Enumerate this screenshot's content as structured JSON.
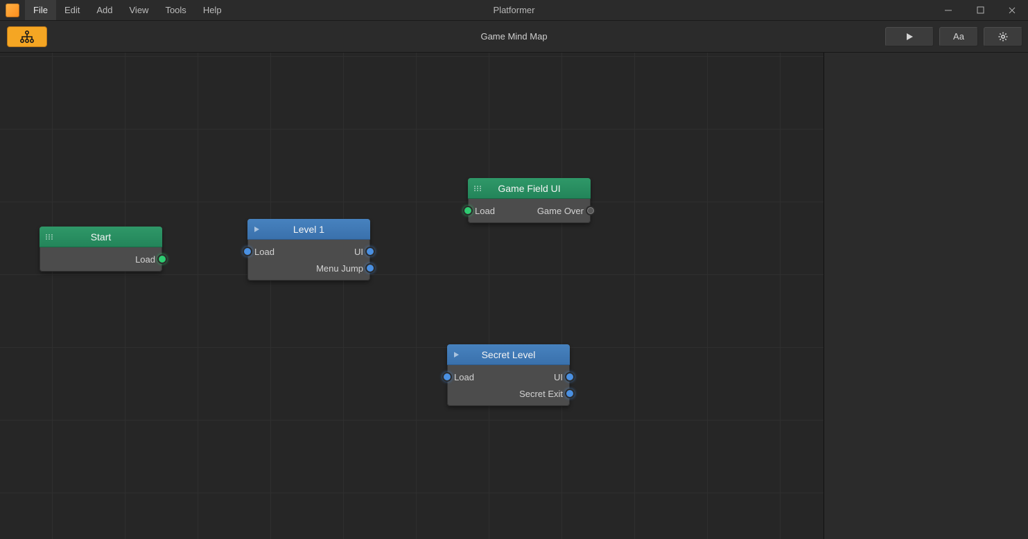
{
  "window": {
    "title": "Platformer"
  },
  "menu": {
    "items": [
      "File",
      "Edit",
      "Add",
      "View",
      "Tools",
      "Help"
    ],
    "active_index": 0
  },
  "toolbar": {
    "title": "Game Mind Map"
  },
  "toolbar_right": {
    "font_label": "Aa"
  },
  "nodes": {
    "start": {
      "title": "Start",
      "out_load": "Load"
    },
    "level1": {
      "title": "Level 1",
      "in_load": "Load",
      "out_ui": "UI",
      "out_menu": "Menu Jump"
    },
    "gameui": {
      "title": "Game Field UI",
      "in_load": "Load",
      "out_over": "Game Over"
    },
    "secret": {
      "title": "Secret Level",
      "in_load": "Load",
      "out_ui": "UI",
      "out_exit": "Secret Exit"
    }
  }
}
